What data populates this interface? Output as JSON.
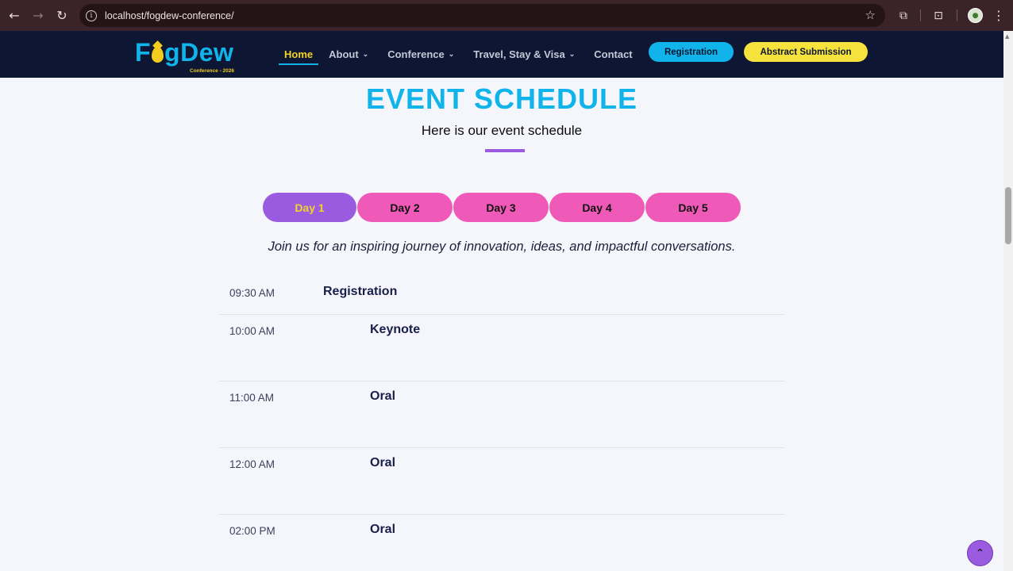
{
  "browser": {
    "url": "localhost/fogdew-conference/",
    "back_icon": "←",
    "forward_icon": "→",
    "reload_icon": "↻",
    "star_icon": "☆",
    "extensions_icon": "⧉",
    "cast_icon": "⊡",
    "menu_icon": "⋮"
  },
  "header": {
    "logo_left": "F",
    "logo_right": "gDew",
    "logo_sub": "Conference - 2026",
    "nav": [
      {
        "label": "Home"
      },
      {
        "label": "About"
      },
      {
        "label": "Conference"
      },
      {
        "label": "Travel, Stay & Visa"
      },
      {
        "label": "Contact"
      }
    ],
    "caret": "⌄",
    "register_label": "Registration",
    "abstract_label": "Abstract Submission"
  },
  "main": {
    "title": "EVENT SCHEDULE",
    "subtitle": "Here is our event schedule",
    "tabs": [
      {
        "label": "Day 1"
      },
      {
        "label": "Day 2"
      },
      {
        "label": "Day 3"
      },
      {
        "label": "Day 4"
      },
      {
        "label": "Day 5"
      }
    ],
    "intro": "Join us for an inspiring journey of innovation, ideas, and impactful conversations.",
    "schedule": [
      {
        "time": "09:30 AM",
        "event": "Registration"
      },
      {
        "time": "10:00 AM",
        "event": "Keynote"
      },
      {
        "time": "11:00 AM",
        "event": "Oral"
      },
      {
        "time": "12:00 AM",
        "event": "Oral"
      },
      {
        "time": "02:00 PM",
        "event": "Oral"
      }
    ]
  },
  "colors": {
    "accent_blue": "#10b4ea",
    "accent_purple": "#9a5be0",
    "accent_pink": "#ef5ab8",
    "accent_yellow": "#f6e23c",
    "header_bg": "#0d1633"
  },
  "to_top_icon": "⌃"
}
